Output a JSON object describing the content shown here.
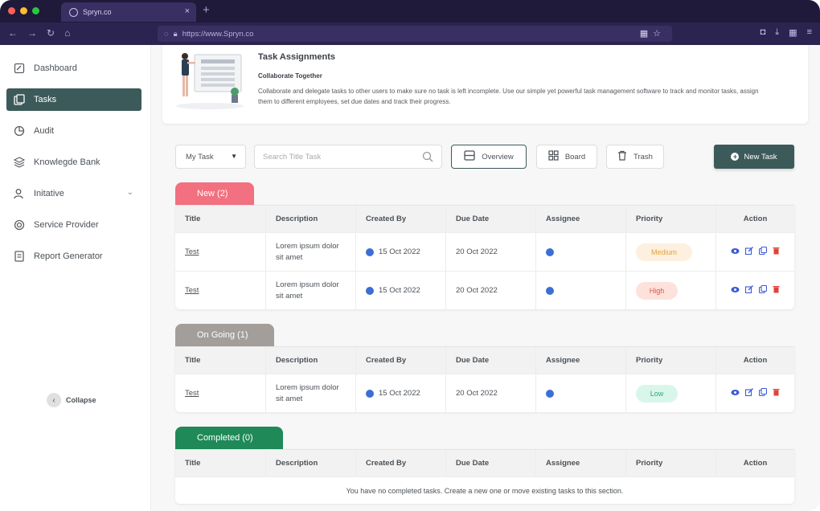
{
  "browser": {
    "tab_title": "Spryn.co",
    "url": "https://www.Spryn.co"
  },
  "sidebar": {
    "items": [
      {
        "label": "Dashboard",
        "icon": "dashboard-icon"
      },
      {
        "label": "Tasks",
        "icon": "tasks-icon",
        "active": true
      },
      {
        "label": "Audit",
        "icon": "audit-icon"
      },
      {
        "label": "Knowlegde Bank",
        "icon": "knowledge-bank-icon"
      },
      {
        "label": "Initative",
        "icon": "initiative-icon",
        "has_chevron": true
      },
      {
        "label": "Service Provider",
        "icon": "service-provider-icon"
      },
      {
        "label": "Report Generator",
        "icon": "report-generator-icon"
      }
    ],
    "collapse_label": "Collapse"
  },
  "banner": {
    "title": "Task Assignments",
    "subtitle": "Collaborate Together",
    "description": "Collaborate and delegate tasks to other users to make sure no task is left incomplete. Use our simple yet powerful task management software to track and monitor tasks, assign them to different employees, set due dates and track their progress."
  },
  "toolbar": {
    "filter_value": "My Task",
    "search_placeholder": "Search Title Task",
    "overview_label": "Overview",
    "board_label": "Board",
    "trash_label": "Trash",
    "new_task_label": "New Task"
  },
  "columns": [
    "Title",
    "Description",
    "Created By",
    "Due Date",
    "Assignee",
    "Priority",
    "Action"
  ],
  "groups": [
    {
      "label": "New (2)",
      "color": "#f2707f",
      "rows": [
        {
          "title": "Test",
          "description": "Lorem ipsum dolor sit amet",
          "created_by": "15 Oct 2022",
          "due_date": "20 Oct 2022",
          "priority": "Medium"
        },
        {
          "title": "Test",
          "description": "Lorem ipsum dolor sit amet",
          "created_by": "15 Oct 2022",
          "due_date": "20 Oct 2022",
          "priority": "High"
        }
      ]
    },
    {
      "label": "On Going (1)",
      "color": "#a39e9a",
      "rows": [
        {
          "title": "Test",
          "description": "Lorem ipsum dolor sit amet",
          "created_by": "15 Oct 2022",
          "due_date": "20 Oct 2022",
          "priority": "Low"
        }
      ]
    },
    {
      "label": "Completed (0)",
      "color": "#1f8a57",
      "empty_message": "You have no completed tasks. Create a new one or move existing tasks to this section."
    }
  ],
  "priority_colors": {
    "Medium": {
      "bg": "#fdf0de",
      "fg": "#e0a040"
    },
    "High": {
      "bg": "#fde2dc",
      "fg": "#e0523a"
    },
    "Low": {
      "bg": "#d9f6ea",
      "fg": "#2fa874"
    }
  },
  "accent": "#3d5a5a"
}
